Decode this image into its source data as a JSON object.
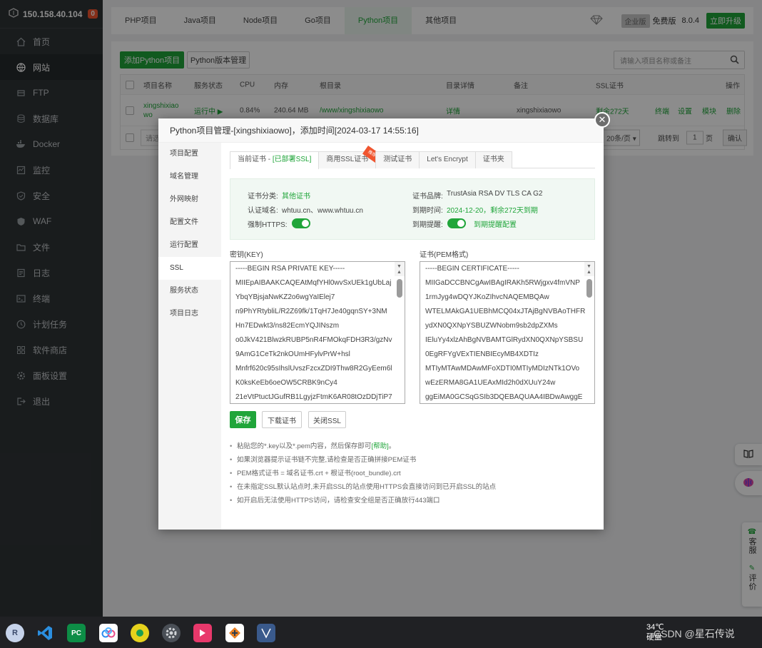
{
  "sidebar": {
    "server_ip": "150.158.40.104",
    "badge": "0",
    "items": [
      {
        "label": "首页",
        "icon": "home-icon"
      },
      {
        "label": "网站",
        "icon": "globe-icon"
      },
      {
        "label": "FTP",
        "icon": "ftp-icon"
      },
      {
        "label": "数据库",
        "icon": "database-icon"
      },
      {
        "label": "Docker",
        "icon": "docker-icon"
      },
      {
        "label": "监控",
        "icon": "monitor-icon"
      },
      {
        "label": "安全",
        "icon": "shield-icon"
      },
      {
        "label": "WAF",
        "icon": "waf-icon"
      },
      {
        "label": "文件",
        "icon": "folder-icon"
      },
      {
        "label": "日志",
        "icon": "log-icon"
      },
      {
        "label": "终端",
        "icon": "terminal-icon"
      },
      {
        "label": "计划任务",
        "icon": "clock-icon"
      },
      {
        "label": "软件商店",
        "icon": "store-icon"
      },
      {
        "label": "面板设置",
        "icon": "settings-icon"
      },
      {
        "label": "退出",
        "icon": "logout-icon"
      }
    ]
  },
  "top_tabs": [
    "PHP项目",
    "Java项目",
    "Node项目",
    "Go项目",
    "Python项目",
    "其他项目"
  ],
  "edition": {
    "enterprise": "企业版",
    "free": "免费版",
    "version": "8.0.4",
    "upgrade": "立即升级"
  },
  "toolbar": {
    "add": "添加Python项目",
    "version_mgr": "Python版本管理",
    "search_placeholder": "请输入项目名称或备注"
  },
  "table": {
    "headers": [
      "项目名称",
      "服务状态",
      "CPU",
      "内存",
      "根目录",
      "目录详情",
      "备注",
      "SSL证书",
      "操作"
    ],
    "row": {
      "name": "xingshixiao wo",
      "status": "运行中 ▶",
      "cpu": "0.84%",
      "mem": "240.64 MB",
      "root": "/www/xingshixiaowo",
      "detail": "详情",
      "note": "xingshixiaowo",
      "ssl": "剩余272天",
      "actions": [
        "终端",
        "设置",
        "模块",
        "删除"
      ]
    },
    "footer": {
      "batch": "请选",
      "per_page": "20条/页",
      "goto": "跳转到",
      "page": "1",
      "page_unit": "页",
      "confirm": "确认"
    }
  },
  "modal": {
    "title": "Python项目管理-[xingshixiaowo]，添加时间[2024-03-17 14:55:16]",
    "nav": [
      "项目配置",
      "域名管理",
      "外网映射",
      "配置文件",
      "运行配置",
      "SSL",
      "服务状态",
      "项目日志"
    ],
    "tabs": [
      "当前证书 - ",
      "[已部署SSL]",
      "商用SSL证书",
      "测试证书",
      "Let's Encrypt",
      "证书夹"
    ],
    "ribbon": "推荐",
    "info": {
      "category_label": "证书分类:",
      "category_value": "其他证书",
      "brand_label": "证书品牌:",
      "brand_value": "TrustAsia RSA DV TLS CA G2",
      "domain_label": "认证域名:",
      "domain_value": "whtuu.cn、www.whtuu.cn",
      "expire_label": "到期时间:",
      "expire_value": "2024-12-20，剩余272天到期",
      "https_label": "强制HTTPS:",
      "remind_label": "到期提醒:",
      "remind_value": "到期提醒配置"
    },
    "key_label": "密钥(KEY)",
    "pem_label": "证书(PEM格式)",
    "key_lines": [
      "-----BEGIN RSA PRIVATE KEY-----",
      "MIIEpAIBAAKCAQEAtMqfYHl0wvSxUEk1gUbLaj",
      "YbqYBjsjaNwKZ2o6wgYaIElej7",
      "n9PhYRtybliL/R2Z69fk/1TqH7Je40gqnSY+3NM",
      "Hn7EDwkt3/ns82EcmYQJINszm",
      "o0JkV421BlwzkRUBP5nR4FMOkqFDH3R3/gzNv",
      "9AmG1CeTk2nkOUmHFylvPrW+hsl",
      "Mnfrf620c95sIhslUvszFzcxZDI9Thw8R2GyEem6l",
      "K0ksKeEb6oeOW5CRBK9nCy4",
      "21eVtPtuctJGufRB1LgyjzFtmK6AR08tOzDDjTiP7"
    ],
    "pem_lines": [
      "-----BEGIN CERTIFICATE-----",
      "MIIGaDCCBNCgAwIBAgIRAKh5RWjgxv4fmVNP",
      "1rmJyg4wDQYJKoZIhvcNAQEMBQAw",
      "WTELMAkGA1UEBhMCQ04xJTAjBgNVBAoTHFR",
      "ydXN0QXNpYSBUZWNobm9sb2dpZXMs",
      "IEluYy4xlzAhBgNVBAMTGlRydXN0QXNpYSBSU",
      "0EgRFYgVExTIENBIEcyMB4XDTIz",
      "MTIyMTAwMDAwMFoXDTI0MTIyMDIzNTk1OVo",
      "wEzERMA8GA1UEAxMId2h0dXUuY24w",
      "ggEiMA0GCSqGSIb3DQEBAQUAA4IBDwAwggE"
    ],
    "buttons": {
      "save": "保存",
      "download": "下载证书",
      "close_ssl": "关闭SSL"
    },
    "tips": [
      {
        "text": "粘贴您的*.key以及*.pem内容，然后保存即可",
        "link": "[帮助]",
        "end": "。"
      },
      {
        "text": "如果浏览器提示证书链不完整,请检查是否正确拼接PEM证书",
        "link": "",
        "end": ""
      },
      {
        "text": "PEM格式证书 = 域名证书.crt + 根证书(root_bundle).crt",
        "link": "",
        "end": ""
      },
      {
        "text": "在未指定SSL默认站点时,未开启SSL的站点使用HTTPS会直接访问到已开启SSL的站点",
        "link": "",
        "end": ""
      },
      {
        "text": "如开启后无法使用HTTPS访问，请检查安全组是否正确放行443端口",
        "link": "",
        "end": ""
      }
    ]
  },
  "float_right": {
    "service": "客服",
    "review": "评价"
  },
  "taskbar": {
    "weather_temp": "34℃",
    "weather_label": "硬盘",
    "watermark": "CSDN @星石传说"
  }
}
